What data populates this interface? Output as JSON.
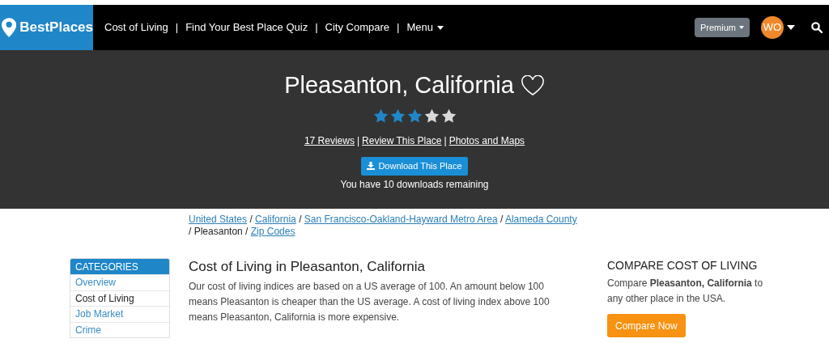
{
  "nav": {
    "logo": "BestPlaces",
    "links": [
      {
        "label": "Cost of Living",
        "separator": "|"
      },
      {
        "label": "Find Your Best Place Quiz",
        "separator": "|"
      },
      {
        "label": "City Compare",
        "separator": "|"
      }
    ],
    "menu": "Menu",
    "premium": "Premium",
    "avatar": "WO"
  },
  "place": {
    "title": "Pleasanton, California",
    "stars": 3,
    "links": [
      {
        "label": "17 Reviews",
        "separator": "|"
      },
      {
        "label": "Review This Place",
        "separator": "|"
      },
      {
        "label": "Photos and Maps"
      }
    ],
    "download": "Download This Place",
    "downloads_note": "You have 10 downloads remaining"
  },
  "breadcrumb": [
    {
      "text": "United States",
      "link": true,
      "separator": "/"
    },
    {
      "text": "California",
      "link": true,
      "separator": "/"
    },
    {
      "text": "San Francisco-Oakland-Hayward Metro Area",
      "link": true,
      "separator": "/"
    },
    {
      "text": "Alameda County",
      "link": true,
      "separator": "/"
    },
    {
      "text": "Pleasanton",
      "link": false,
      "separator": "/"
    },
    {
      "text": "Zip Codes",
      "link": true
    }
  ],
  "sidebar": {
    "title": "CATEGORIES",
    "items": [
      {
        "label": "Overview",
        "selected": false
      },
      {
        "label": "Cost of Living",
        "selected": true
      },
      {
        "label": "Job Market",
        "selected": false
      },
      {
        "label": "Crime",
        "selected": false
      }
    ]
  },
  "article": {
    "heading": "Cost of Living in Pleasanton, California",
    "text": "Our cost of living indices are based on a US average of 100. An amount below 100 means Pleasanton is cheaper than the US average. A cost of living index above 100 means Pleasanton, California is more expensive."
  },
  "compare": {
    "title": "COMPARE COST OF LIVING",
    "text": "Compare **Pleasanton, California** to any other place in the USA.",
    "button": "Compare Now"
  }
}
